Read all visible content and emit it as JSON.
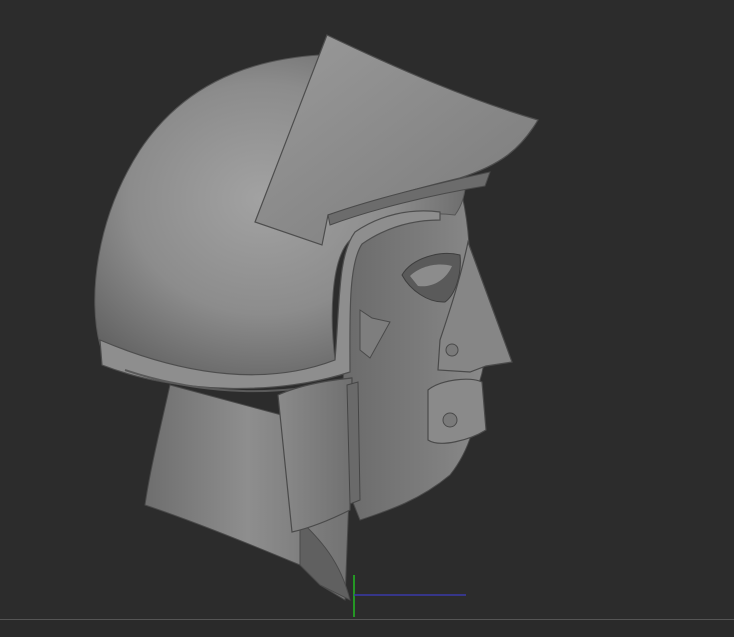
{
  "viewport": {
    "background": "#2c2c2c",
    "model_name": "helmet-head-sculpt",
    "clay_color": "#8a8a8a"
  },
  "gizmo": {
    "x_axis_color": "#3a3aa8",
    "y_axis_color": "#22bb22"
  }
}
